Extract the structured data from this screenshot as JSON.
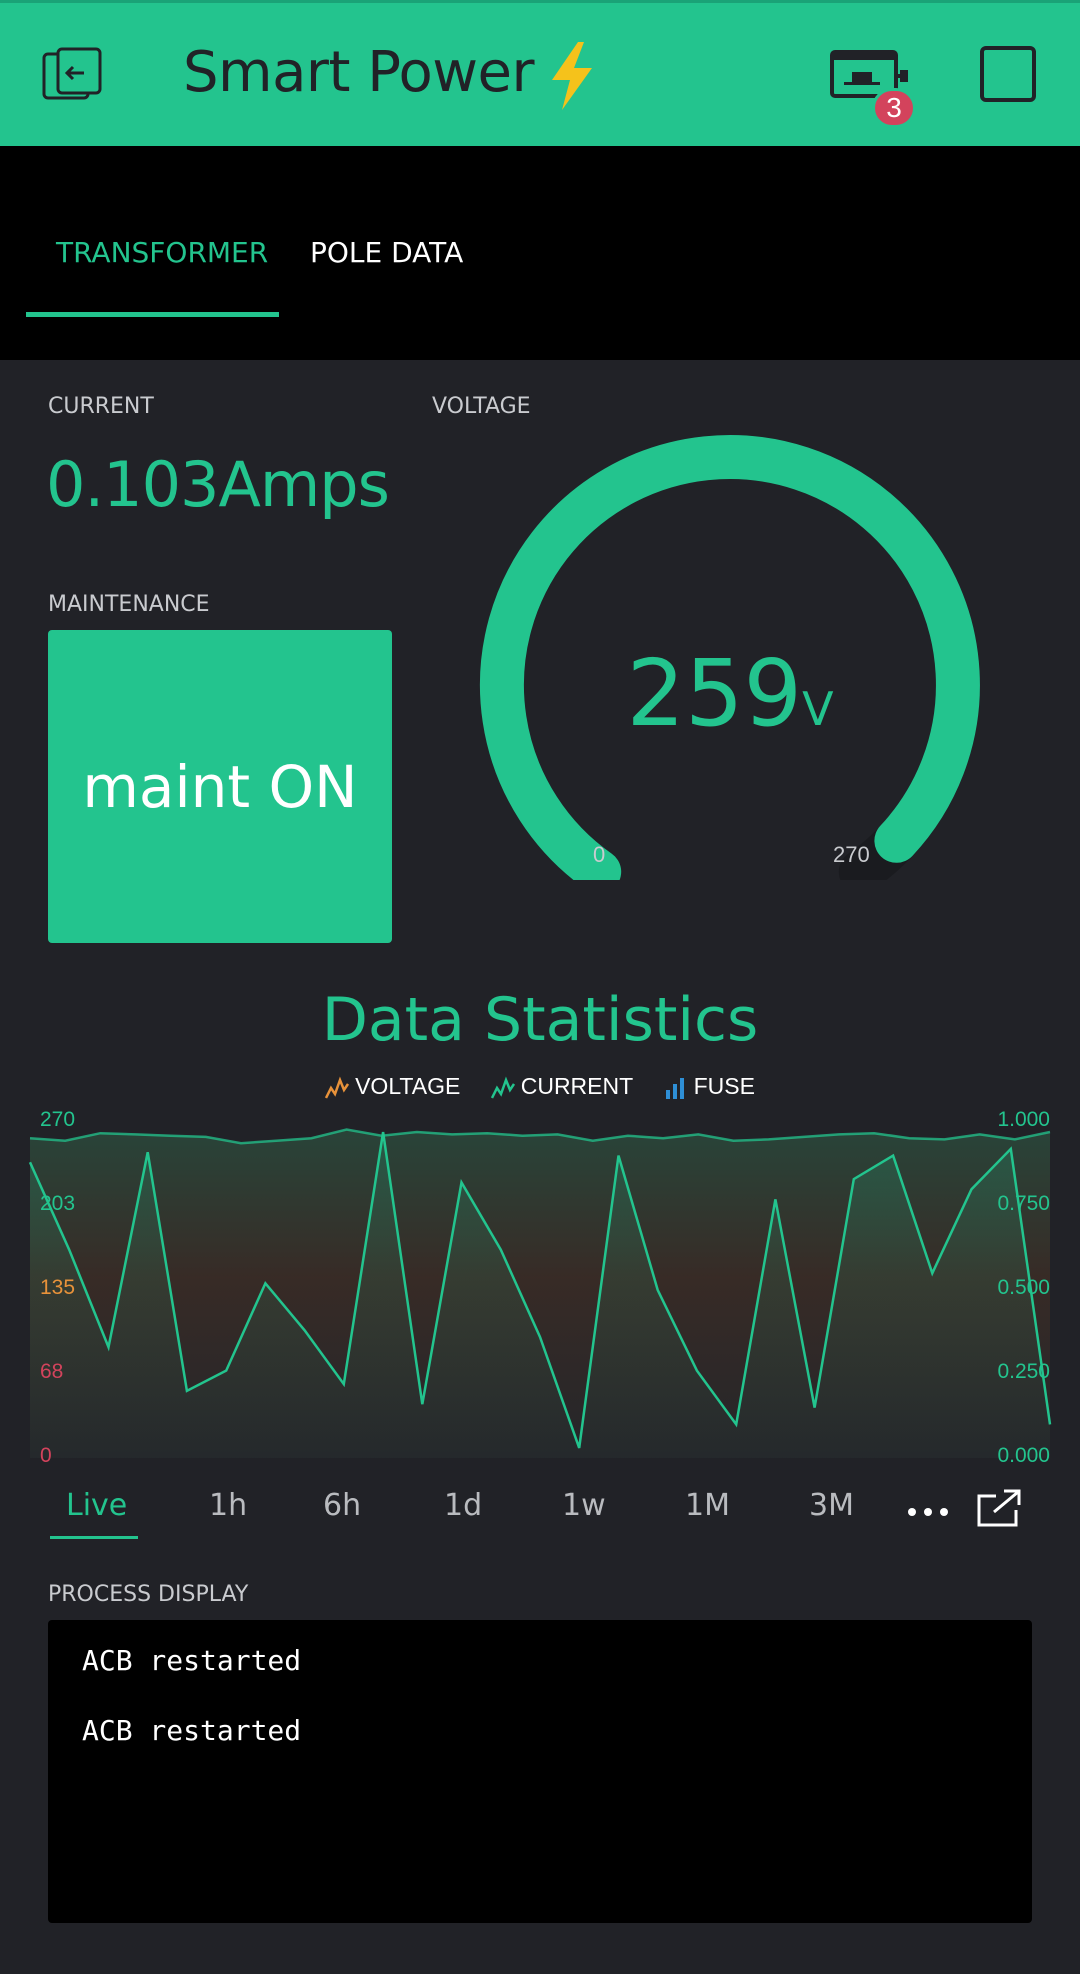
{
  "header": {
    "title": "Smart Power",
    "notification_count": "3",
    "accent_color": "#23c48e",
    "icons": [
      "exit-icon",
      "lightning-icon",
      "device-icon",
      "square-icon"
    ]
  },
  "tabs": [
    {
      "label": "TRANSFORMER",
      "active": true
    },
    {
      "label": "POLE DATA",
      "active": false
    }
  ],
  "current": {
    "label": "CURRENT",
    "value": "0.103Amps"
  },
  "voltage": {
    "label": "VOLTAGE",
    "value": "259",
    "unit": "V",
    "min": "0",
    "max": "270",
    "level": 0.959
  },
  "maintenance": {
    "label": "MAINTENANCE",
    "button_label": "maint ON"
  },
  "stats": {
    "title": "Data Statistics",
    "legend": [
      "VOLTAGE",
      "CURRENT",
      "FUSE"
    ],
    "left_ticks": [
      "270",
      "203",
      "135",
      "68",
      "0"
    ],
    "right_ticks": [
      "1.000",
      "0.750",
      "0.500",
      "0.250",
      "0.000"
    ],
    "time_ranges": [
      "Live",
      "1h",
      "6h",
      "1d",
      "1w",
      "1M",
      "3M"
    ],
    "active_range": "Live"
  },
  "chart_data": {
    "type": "line",
    "ylim_left": [
      0,
      270
    ],
    "ylim_right": [
      0,
      1
    ],
    "series": [
      {
        "name": "VOLTAGE",
        "axis": "left",
        "values": [
          257,
          255,
          261,
          260,
          259,
          258,
          253,
          255,
          257,
          264,
          259,
          262,
          260,
          261,
          259,
          260,
          255,
          259,
          257,
          260,
          255,
          256,
          258,
          260,
          261,
          257,
          256,
          260,
          256,
          262
        ]
      },
      {
        "name": "CURRENT",
        "axis": "right",
        "values": [
          0.88,
          0.62,
          0.33,
          0.91,
          0.2,
          0.26,
          0.52,
          0.38,
          0.22,
          0.97,
          0.16,
          0.82,
          0.62,
          0.36,
          0.03,
          0.9,
          0.5,
          0.26,
          0.1,
          0.77,
          0.15,
          0.83,
          0.9,
          0.55,
          0.8,
          0.92,
          0.1
        ]
      }
    ]
  },
  "process": {
    "label": "PROCESS DISPLAY",
    "lines": [
      "ACB restarted",
      "ACB restarted"
    ]
  }
}
